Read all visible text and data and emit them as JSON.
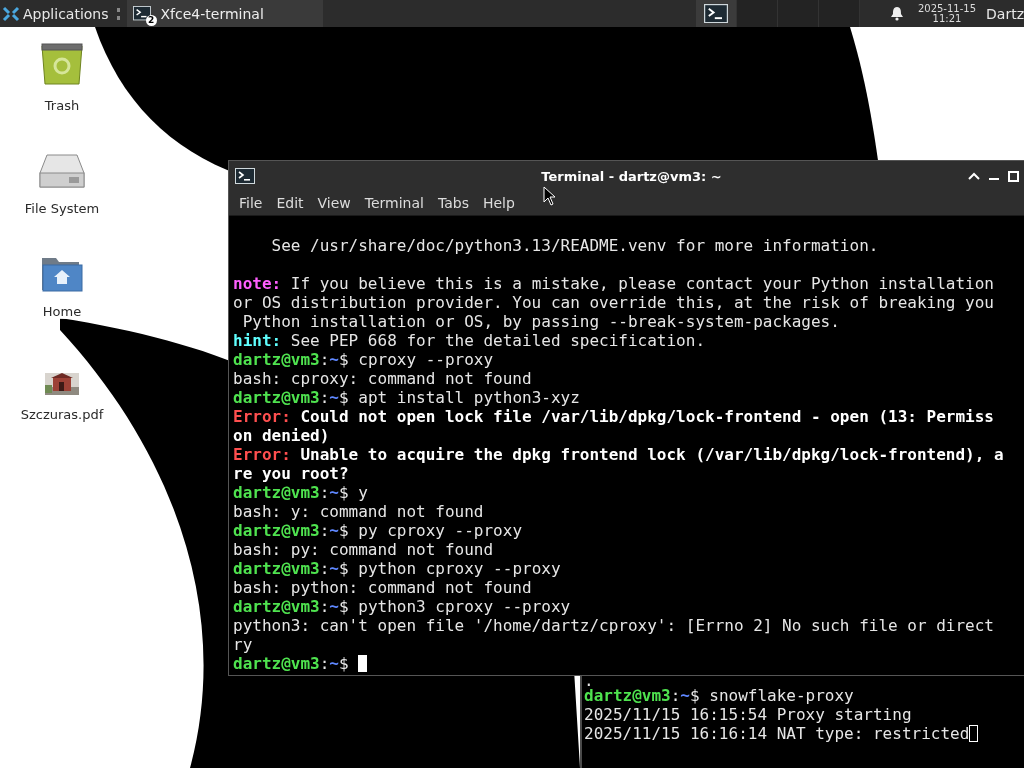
{
  "panel": {
    "menu_label": "Applications",
    "tasks": [
      {
        "label": "Xfce4-terminal",
        "badge": "2",
        "selected": false
      }
    ],
    "date": "2025-11-15",
    "time": "11:21",
    "user": "Dartz"
  },
  "desktop_icons": [
    {
      "kind": "trash",
      "label": "Trash"
    },
    {
      "kind": "drive",
      "label": "File System"
    },
    {
      "kind": "home",
      "label": "Home"
    },
    {
      "kind": "document",
      "label": "Szczuras.pdf"
    }
  ],
  "terminals": [
    {
      "kind": "window",
      "title": "Terminal - dartz@vm3: ~",
      "menu": [
        "File",
        "Edit",
        "View",
        "Terminal",
        "Tabs",
        "Help"
      ],
      "focused": true,
      "lines": [
        {
          "kind": "text",
          "spans": [
            {
              "kind": "plain",
              "text": "    See /usr/share/doc/python3.13/README.venv for more information."
            }
          ]
        },
        {
          "kind": "blank"
        },
        {
          "kind": "text",
          "spans": [
            {
              "kind": "note",
              "text": "note:"
            },
            {
              "kind": "plain",
              "text": " If you believe this is a mistake, please contact your Python installation"
            }
          ]
        },
        {
          "kind": "text",
          "spans": [
            {
              "kind": "plain",
              "text": "or OS distribution provider. You can override this, at the risk of breaking you"
            }
          ]
        },
        {
          "kind": "text",
          "spans": [
            {
              "kind": "plain",
              "text": " Python installation or OS, by passing --break-system-packages."
            }
          ]
        },
        {
          "kind": "text",
          "spans": [
            {
              "kind": "hint",
              "text": "hint:"
            },
            {
              "kind": "plain",
              "text": " See PEP 668 for the detailed specification."
            }
          ]
        },
        {
          "kind": "text",
          "spans": [
            {
              "kind": "user",
              "text": "dartz@vm3"
            },
            {
              "kind": "plain",
              "text": ":"
            },
            {
              "kind": "path",
              "text": "~"
            },
            {
              "kind": "plain",
              "text": "$ cproxy --proxy"
            }
          ]
        },
        {
          "kind": "text",
          "spans": [
            {
              "kind": "plain",
              "text": "bash: cproxy: command not found"
            }
          ]
        },
        {
          "kind": "text",
          "spans": [
            {
              "kind": "user",
              "text": "dartz@vm3"
            },
            {
              "kind": "plain",
              "text": ":"
            },
            {
              "kind": "path",
              "text": "~"
            },
            {
              "kind": "plain",
              "text": "$ apt install python3-xyz"
            }
          ]
        },
        {
          "kind": "text",
          "spans": [
            {
              "kind": "error",
              "text": "Error:"
            },
            {
              "kind": "bold",
              "text": " Could not open lock file /var/lib/dpkg/lock-frontend - open (13: Permiss"
            }
          ]
        },
        {
          "kind": "text",
          "spans": [
            {
              "kind": "bold",
              "text": "on denied)"
            }
          ]
        },
        {
          "kind": "text",
          "spans": [
            {
              "kind": "error",
              "text": "Error:"
            },
            {
              "kind": "bold",
              "text": " Unable to acquire the dpkg frontend lock (/var/lib/dpkg/lock-frontend), a"
            }
          ]
        },
        {
          "kind": "text",
          "spans": [
            {
              "kind": "bold",
              "text": "re you root?"
            }
          ]
        },
        {
          "kind": "text",
          "spans": [
            {
              "kind": "user",
              "text": "dartz@vm3"
            },
            {
              "kind": "plain",
              "text": ":"
            },
            {
              "kind": "path",
              "text": "~"
            },
            {
              "kind": "plain",
              "text": "$ y"
            }
          ]
        },
        {
          "kind": "text",
          "spans": [
            {
              "kind": "plain",
              "text": "bash: y: command not found"
            }
          ]
        },
        {
          "kind": "text",
          "spans": [
            {
              "kind": "user",
              "text": "dartz@vm3"
            },
            {
              "kind": "plain",
              "text": ":"
            },
            {
              "kind": "path",
              "text": "~"
            },
            {
              "kind": "plain",
              "text": "$ py cproxy --proxy"
            }
          ]
        },
        {
          "kind": "text",
          "spans": [
            {
              "kind": "plain",
              "text": "bash: py: command not found"
            }
          ]
        },
        {
          "kind": "text",
          "spans": [
            {
              "kind": "user",
              "text": "dartz@vm3"
            },
            {
              "kind": "plain",
              "text": ":"
            },
            {
              "kind": "path",
              "text": "~"
            },
            {
              "kind": "plain",
              "text": "$ python cproxy --proxy"
            }
          ]
        },
        {
          "kind": "text",
          "spans": [
            {
              "kind": "plain",
              "text": "bash: python: command not found"
            }
          ]
        },
        {
          "kind": "text",
          "spans": [
            {
              "kind": "user",
              "text": "dartz@vm3"
            },
            {
              "kind": "plain",
              "text": ":"
            },
            {
              "kind": "path",
              "text": "~"
            },
            {
              "kind": "plain",
              "text": "$ python3 cproxy --proxy"
            }
          ]
        },
        {
          "kind": "text",
          "spans": [
            {
              "kind": "plain",
              "text": "python3: can't open file '/home/dartz/cproxy': [Errno 2] No such file or direct"
            }
          ]
        },
        {
          "kind": "text",
          "spans": [
            {
              "kind": "plain",
              "text": "ry"
            }
          ]
        },
        {
          "kind": "text",
          "spans": [
            {
              "kind": "user",
              "text": "dartz@vm3"
            },
            {
              "kind": "plain",
              "text": ":"
            },
            {
              "kind": "path",
              "text": "~"
            },
            {
              "kind": "plain",
              "text": "$ "
            }
          ]
        }
      ]
    },
    {
      "kind": "pane",
      "focused": false,
      "lines": [
        {
          "kind": "partial",
          "spans": [
            {
              "kind": "plain",
              "text": "."
            }
          ]
        },
        {
          "kind": "text",
          "spans": [
            {
              "kind": "user",
              "text": "dartz@vm3"
            },
            {
              "kind": "plain",
              "text": ":"
            },
            {
              "kind": "path",
              "text": "~"
            },
            {
              "kind": "plain",
              "text": "$ snowflake-proxy"
            }
          ]
        },
        {
          "kind": "text",
          "spans": [
            {
              "kind": "plain",
              "text": "2025/11/15 16:15:54 Proxy starting"
            }
          ]
        },
        {
          "kind": "text",
          "spans": [
            {
              "kind": "plain",
              "text": "2025/11/15 16:16:14 NAT type: restricted"
            }
          ]
        }
      ]
    }
  ]
}
